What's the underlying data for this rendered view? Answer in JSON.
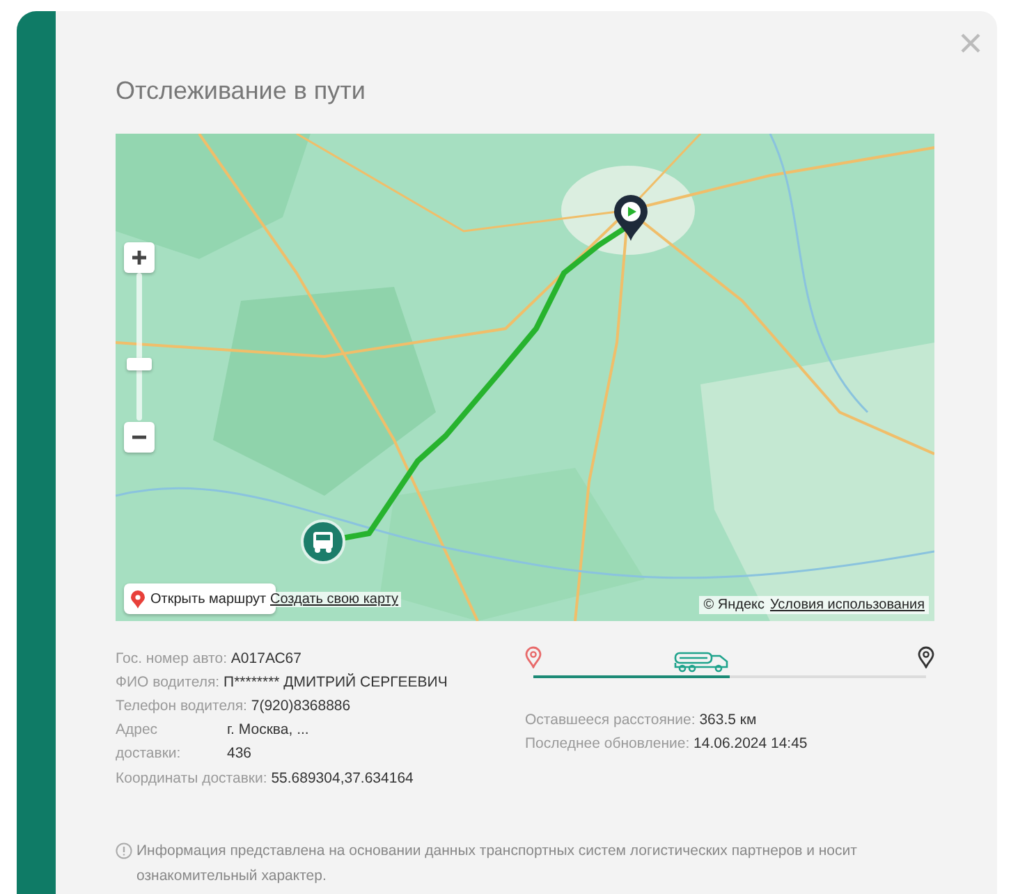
{
  "modal": {
    "title": "Отслеживание в пути"
  },
  "map": {
    "zoom": {
      "level": 0.38
    },
    "open_route_button": "Открыть маршрут",
    "create_map_link": "Создать свою карту",
    "copyright": "© Яндекс",
    "terms_link": "Условия использования"
  },
  "details": [
    {
      "label": "Гос. номер авто:",
      "value": "А017АС67"
    },
    {
      "label": "ФИО водителя:",
      "value": "П******** ДМИТРИЙ СЕРГЕЕВИЧ"
    },
    {
      "label": "Телефон водителя:",
      "value": "7(920)8368886"
    },
    {
      "label": "Адрес\nдоставки:",
      "value": "г. Москва, ...\n436",
      "kind": "block"
    },
    {
      "label": "Координаты доставки:",
      "value": "55.689304,37.634164"
    }
  ],
  "progress": {
    "level": 0.5
  },
  "status": [
    {
      "label": "Оставшееся расстояние:",
      "value": "363.5 км"
    },
    {
      "label": "Последнее обновление:",
      "value": "14.06.2024 14:45"
    }
  ],
  "note": "Информация представлена на основании данных транспортных систем логистических партнеров и носит ознакомительный характер."
}
